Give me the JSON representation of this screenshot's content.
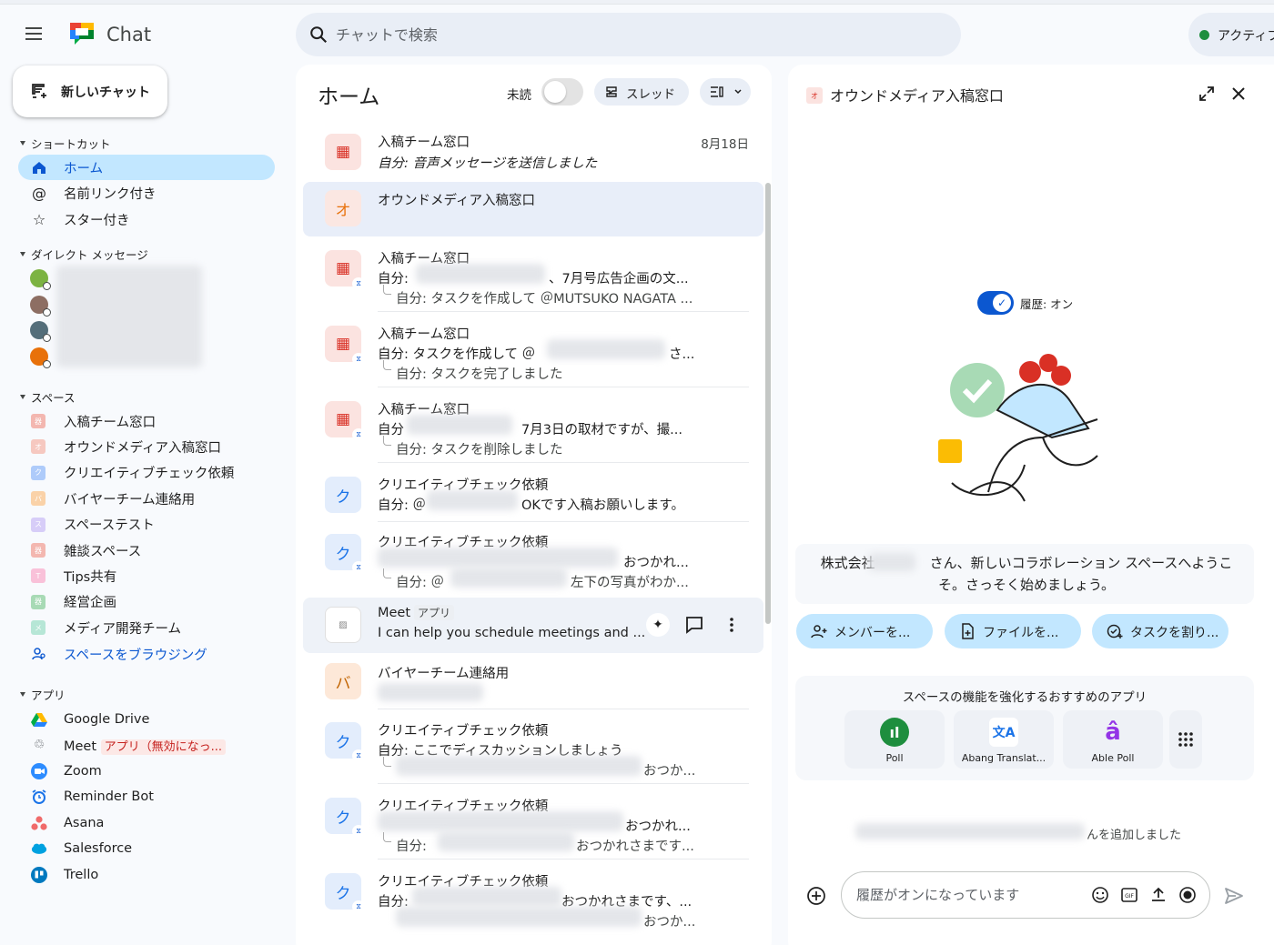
{
  "app": {
    "title": "Chat"
  },
  "search": {
    "placeholder": "チャットで検索"
  },
  "status": {
    "label": "アクティブ"
  },
  "sidebar": {
    "new_chat": "新しいチャット",
    "shortcuts_head": "ショートカット",
    "shortcuts": [
      {
        "label": "ホーム"
      },
      {
        "label": "名前リンク付き"
      },
      {
        "label": "スター付き"
      }
    ],
    "dm_head": "ダイレクト メッセージ",
    "spaces_head": "スペース",
    "spaces": [
      {
        "label": "入稿チーム窓口",
        "icon": "器",
        "color": "#f3b7b0"
      },
      {
        "label": "オウンドメディア入稿窓口",
        "icon": "オ",
        "color": "#f6c8c0"
      },
      {
        "label": "クリエイティブチェック依頼",
        "icon": "ク",
        "color": "#aecbfa"
      },
      {
        "label": "バイヤーチーム連絡用",
        "icon": "バ",
        "color": "#fad2a8"
      },
      {
        "label": "スペーステスト",
        "icon": "ス",
        "color": "#d7cdf8"
      },
      {
        "label": "雑談スペース",
        "icon": "器",
        "color": "#f3b7b0"
      },
      {
        "label": "Tips共有",
        "icon": "T",
        "color": "#f9c1d9"
      },
      {
        "label": "経営企画",
        "icon": "器",
        "color": "#a8dab5"
      },
      {
        "label": "メディア開発チーム",
        "icon": "メ",
        "color": "#b6e6d6"
      }
    ],
    "browse_spaces": "スペースをブラウジング",
    "apps_head": "アプリ",
    "apps": [
      {
        "label": "Google Drive"
      },
      {
        "label": "Meet",
        "badge": "アプリ（無効になっ..."
      },
      {
        "label": "Zoom"
      },
      {
        "label": "Reminder Bot"
      },
      {
        "label": "Asana"
      },
      {
        "label": "Salesforce"
      },
      {
        "label": "Trello"
      }
    ]
  },
  "home": {
    "title": "ホーム",
    "unread_label": "未読",
    "thread_label": "スレッド",
    "conversations": [
      {
        "name": "入稿チーム窓口",
        "date": "8月18日",
        "line2": "自分: 音声メッセージを送信しました"
      },
      {
        "name": "オウンドメディア入稿窓口",
        "avatar": "オ"
      },
      {
        "name": "入稿チーム窓口",
        "line2a": "自分:",
        "line2b": "、7月号広告企画の文...",
        "line3": "自分: タスクを作成して ＠MUTSUKO NAGATA ..."
      },
      {
        "name": "入稿チーム窓口",
        "line2a": "自分: タスクを作成して ＠",
        "line2b": "さ...",
        "line3": "自分: タスクを完了しました"
      },
      {
        "name": "入稿チーム窓口",
        "line2a": "自分",
        "line2b": "7月3日の取材ですが、撮...",
        "line3": "自分: タスクを削除しました"
      },
      {
        "name": "クリエイティブチェック依頼",
        "avatar": "ク",
        "line2a": "自分: ＠",
        "line2b": "OKです入稿お願いします。"
      },
      {
        "name": "クリエイティブチェック依頼",
        "avatar": "ク",
        "line2b": "おつかれ...",
        "line3a": "自分: ＠",
        "line3b": "左下の写真がわか..."
      },
      {
        "name": "Meet",
        "chip": "アプリ",
        "line2": "I can help you schedule meetings and ..."
      },
      {
        "name": "バイヤーチーム連絡用",
        "avatar": "バ"
      },
      {
        "name": "クリエイティブチェック依頼",
        "avatar": "ク",
        "line2": "自分: ここでディスカッションしましょう",
        "line3b": "おつか..."
      },
      {
        "name": "クリエイティブチェック依頼",
        "avatar": "ク",
        "line2b": "おつかれ...",
        "line3a": "自分:",
        "line3b": "おつかれさまです..."
      },
      {
        "name": "クリエイティブチェック依頼",
        "avatar": "ク",
        "line2a": "自分:",
        "line2b": "おつかれさまです、...",
        "line3b": "おつか..."
      }
    ]
  },
  "space_panel": {
    "badge": "オ",
    "title": "オウンドメディア入稿窓口",
    "history_label": "履歴: オン",
    "welcome": "株式会社　　　　さん、新しいコラボレーション スペースへようこそ。さっそく始めましょう。",
    "actions": [
      {
        "label": "メンバーを..."
      },
      {
        "label": "ファイルを..."
      },
      {
        "label": "タスクを割り..."
      }
    ],
    "apps_head": "スペースの機能を強化するおすすめのアプリ",
    "apps": [
      {
        "label": "Poll"
      },
      {
        "label": "Abang Translat..."
      },
      {
        "label": "Able Poll"
      }
    ],
    "added_text": "んを追加しました",
    "composer_placeholder": "履歴がオンになっています"
  },
  "colors": {
    "accent": "#0b57d0",
    "active_bg": "#c2e7ff",
    "presence": "#1e8e3e"
  }
}
